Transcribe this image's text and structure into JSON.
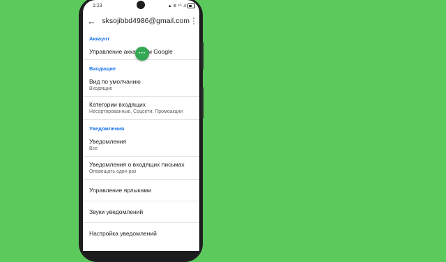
{
  "status": {
    "time": "1:23",
    "icons": "▲ ⊕ ⁴ᴳ .ıl",
    "battery": ""
  },
  "topbar": {
    "back_icon": "arrow-back-icon",
    "account": "sksojibbd4986@gmail.com",
    "more_icon": "more-vert-icon"
  },
  "sections": {
    "account": "Аккаунт",
    "inbox": "Входящие",
    "notifications": "Уведомления"
  },
  "items": {
    "manage_account": {
      "title": "Управление аккаунтом Google"
    },
    "default_view": {
      "title": "Вид по умолчанию",
      "subtitle": "Входящие"
    },
    "inbox_categories": {
      "title": "Категории входящих",
      "subtitle": "Несортированные, Соцсети, Промоакции"
    },
    "notifications": {
      "title": "Уведомления",
      "subtitle": "Все"
    },
    "inbox_notifications": {
      "title": "Уведомления о входящих письмах",
      "subtitle": "Оповещать один раз"
    },
    "manage_labels": {
      "title": "Управление ярлыками"
    },
    "notification_sounds": {
      "title": "Звуки уведомлений"
    },
    "notification_settings": {
      "title": "Настройка уведомлений"
    }
  },
  "overlay": {
    "dots": "···"
  },
  "colors": {
    "background": "#5cc95c",
    "accent": "#1a73e8",
    "dot": "#34a853"
  }
}
